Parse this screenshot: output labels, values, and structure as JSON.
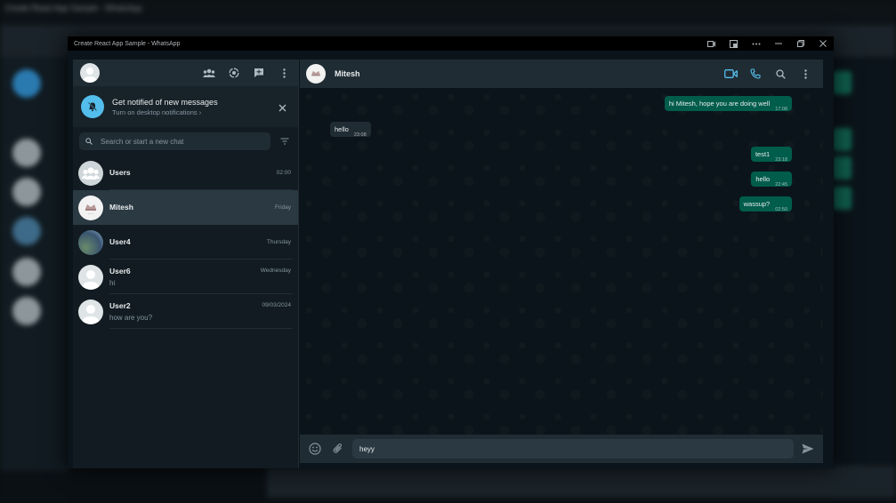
{
  "window": {
    "title": "Create React App Sample - WhatsApp"
  },
  "background_app": {
    "title": "Create React App Sample - WhatsApp"
  },
  "sidebar": {
    "header_icons": [
      "communities-icon",
      "status-icon",
      "new-chat-icon",
      "menu-icon"
    ],
    "notification": {
      "title": "Get notified of new messages",
      "subtitle": "Turn on desktop notifications ›"
    },
    "search": {
      "placeholder": "Search or start a new chat"
    },
    "chats": [
      {
        "name": "Users",
        "time": "02:00",
        "preview": "",
        "avatar": "group"
      },
      {
        "name": "Mitesh",
        "time": "Friday",
        "preview": "",
        "avatar": "logo"
      },
      {
        "name": "User4",
        "time": "Thursday",
        "preview": "",
        "avatar": "photo"
      },
      {
        "name": "User6",
        "time": "Wednesday",
        "preview": "hi",
        "avatar": "default"
      },
      {
        "name": "User2",
        "time": "09/03/2024",
        "preview": "how are you?",
        "avatar": "default"
      }
    ]
  },
  "conversation": {
    "name": "Mitesh",
    "messages": [
      {
        "text": "hi Mitesh, hope you are doing well",
        "time": "17:08",
        "direction": "out"
      },
      {
        "text": "hello",
        "time": "23:08",
        "direction": "in"
      },
      {
        "text": "test1",
        "time": "23:18",
        "direction": "out"
      },
      {
        "text": "hello",
        "time": "22:45",
        "direction": "out"
      },
      {
        "text": "wassup?",
        "time": "02:50",
        "direction": "out"
      }
    ],
    "composer": {
      "value": "heyy"
    }
  },
  "colors": {
    "accent": "#53bdeb",
    "outgoing_bubble": "#005c4b",
    "incoming_bubble": "#202c33",
    "panel": "#111b21",
    "header": "#202c33"
  }
}
